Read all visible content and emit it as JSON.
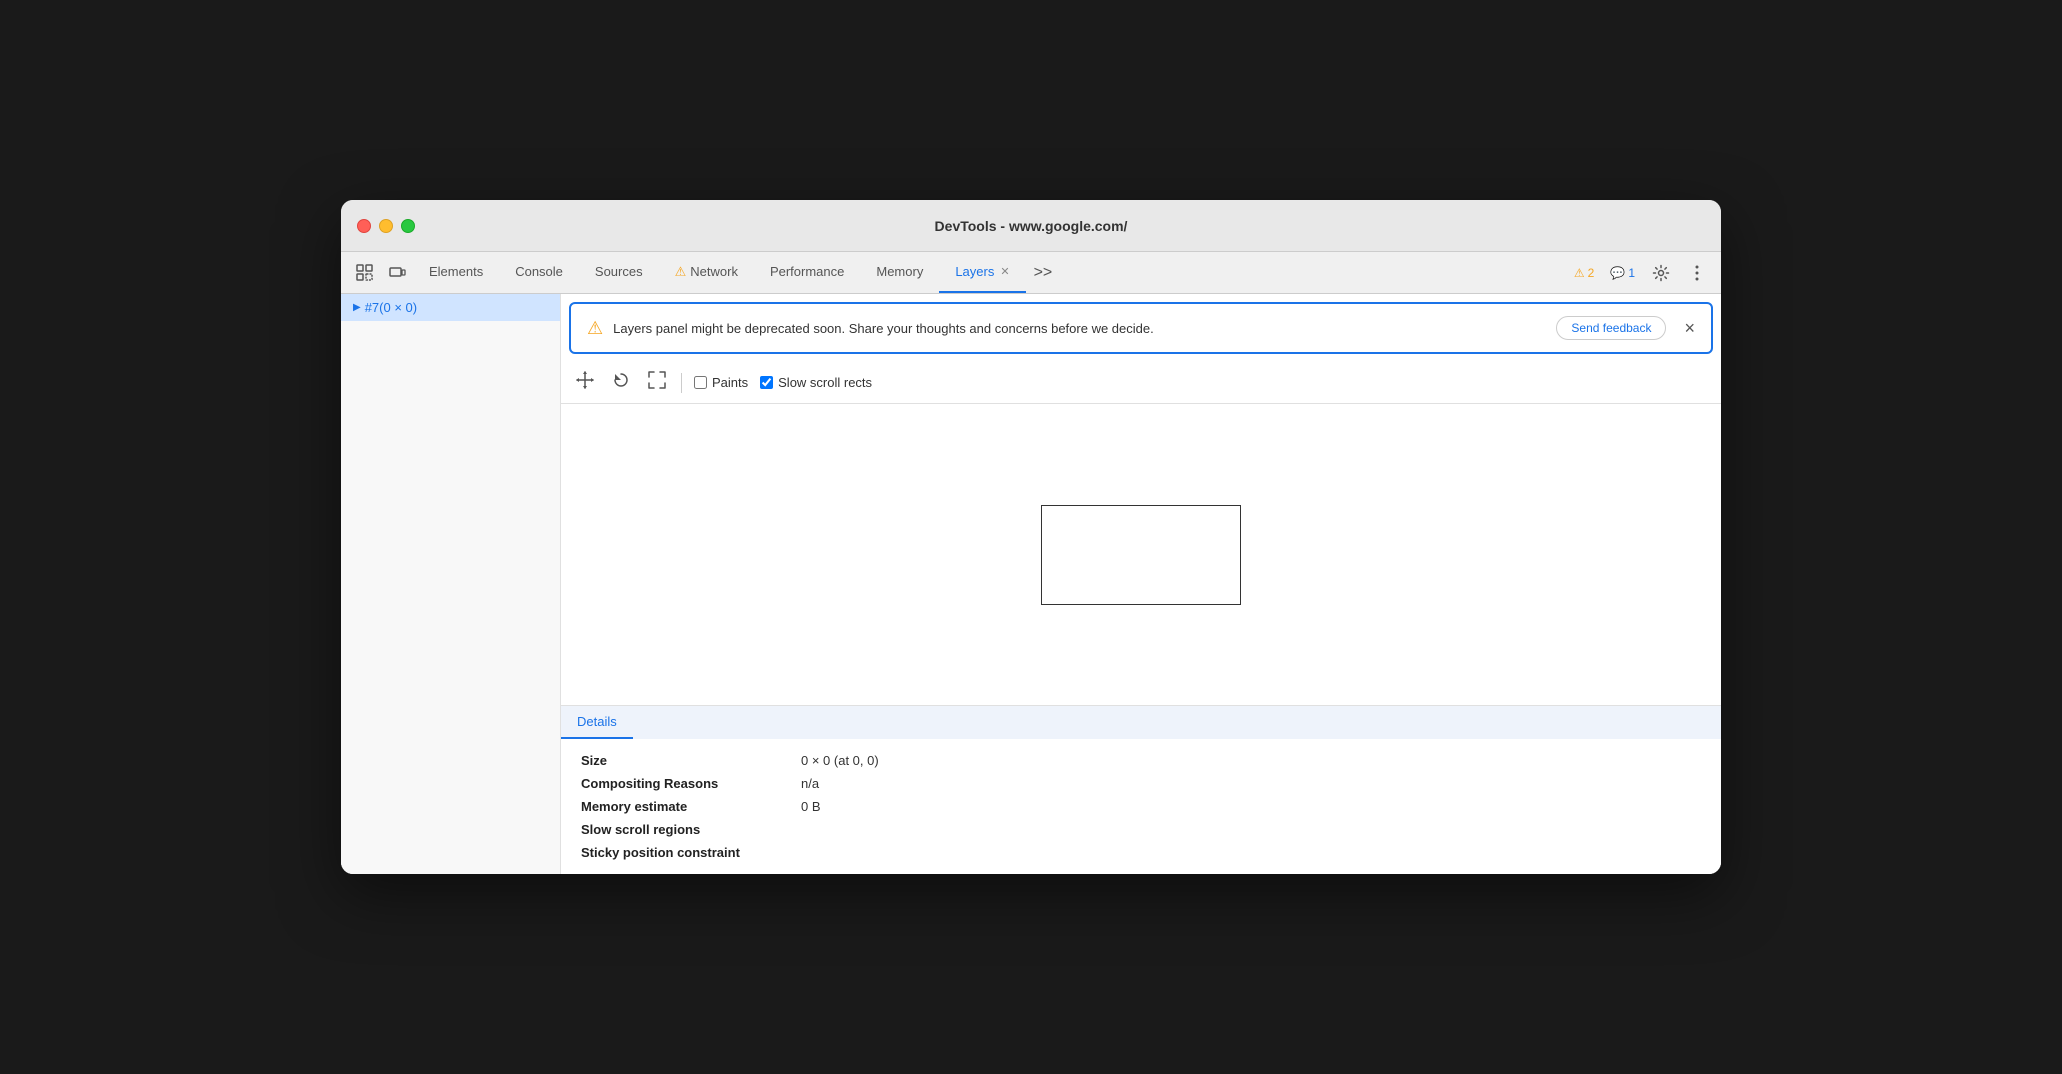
{
  "window": {
    "title": "DevTools - www.google.com/"
  },
  "toolbar": {
    "icons": {
      "inspect": "⬚",
      "device": "▭"
    },
    "tabs": [
      {
        "id": "elements",
        "label": "Elements",
        "active": false,
        "hasWarning": false,
        "hasClose": false
      },
      {
        "id": "console",
        "label": "Console",
        "active": false,
        "hasWarning": false,
        "hasClose": false
      },
      {
        "id": "sources",
        "label": "Sources",
        "active": false,
        "hasWarning": false,
        "hasClose": false
      },
      {
        "id": "network",
        "label": "Network",
        "active": false,
        "hasWarning": true,
        "hasClose": false
      },
      {
        "id": "performance",
        "label": "Performance",
        "active": false,
        "hasWarning": false,
        "hasClose": false
      },
      {
        "id": "memory",
        "label": "Memory",
        "active": false,
        "hasWarning": false,
        "hasClose": false
      },
      {
        "id": "layers",
        "label": "Layers",
        "active": true,
        "hasWarning": false,
        "hasClose": true
      }
    ],
    "more_label": ">>",
    "warning_count": "2",
    "comment_count": "1"
  },
  "sidebar": {
    "items": [
      {
        "label": "#7(0 × 0)",
        "selected": true,
        "arrow": "▶"
      }
    ]
  },
  "banner": {
    "message": "Layers panel might be deprecated soon. Share your thoughts and concerns before we decide.",
    "send_feedback_label": "Send feedback",
    "close_label": "×"
  },
  "layers_toolbar": {
    "pan_icon": "✛",
    "rotate_icon": "↺",
    "fit_icon": "⤢",
    "paints_label": "Paints",
    "paints_checked": false,
    "slow_scroll_label": "Slow scroll rects",
    "slow_scroll_checked": true
  },
  "details": {
    "tab_label": "Details",
    "rows": [
      {
        "key": "Size",
        "value": "0 × 0 (at 0, 0)"
      },
      {
        "key": "Compositing Reasons",
        "value": "n/a"
      },
      {
        "key": "Memory estimate",
        "value": "0 B"
      },
      {
        "key": "Slow scroll regions",
        "value": ""
      },
      {
        "key": "Sticky position constraint",
        "value": ""
      }
    ]
  }
}
